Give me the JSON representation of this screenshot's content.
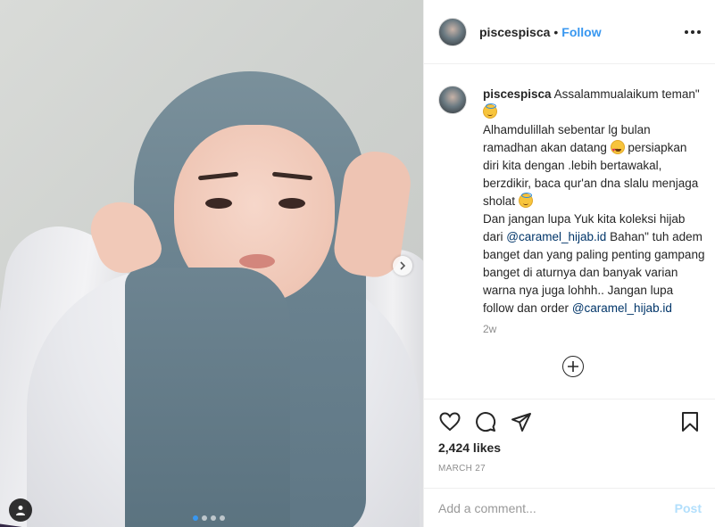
{
  "header": {
    "username": "piscespisca",
    "separator": "•",
    "follow_label": "Follow"
  },
  "caption": {
    "username": "piscespisca",
    "line1": "Assalammualaikum teman\"",
    "line2": "Alhamdulillah sebentar lg bulan ramadhan akan datang",
    "line3": "persiapkan diri kita dengan .lebih bertawakal, berzdikir, baca qur'an dna slalu menjaga sholat",
    "line4_pre": "Dan jangan lupa Yuk kita koleksi hijab dari",
    "mention1": "@caramel_hijab.id",
    "line4_post": "Bahan\" tuh adem banget dan yang paling penting gampang banget di aturnya dan banyak varian warna nya juga lohhh.. Jangan lupa follow dan order",
    "mention2": "@caramel_hijab.id",
    "emojis": [
      "smiling-face-with-halo",
      "heart-eyes",
      "smiling-face-with-halo"
    ]
  },
  "timestamp_relative": "2w",
  "likes": "2,424 likes",
  "date": "MARCH 27",
  "comment": {
    "placeholder": "Add a comment...",
    "value": "",
    "post_label": "Post"
  },
  "carousel": {
    "total": 4,
    "active_index": 0
  },
  "colors": {
    "link": "#3897f0",
    "mention": "#003569",
    "muted": "#8e8e8e",
    "post_disabled": "#b2dffc",
    "border": "#efefef"
  },
  "icons": {
    "header_more": "more-options-icon",
    "carousel_next": "chevron-right-icon",
    "user_tag": "person-icon",
    "load_more": "plus-circle-icon",
    "like": "heart-icon",
    "comment": "comment-icon",
    "share": "share-icon",
    "save": "bookmark-icon"
  }
}
